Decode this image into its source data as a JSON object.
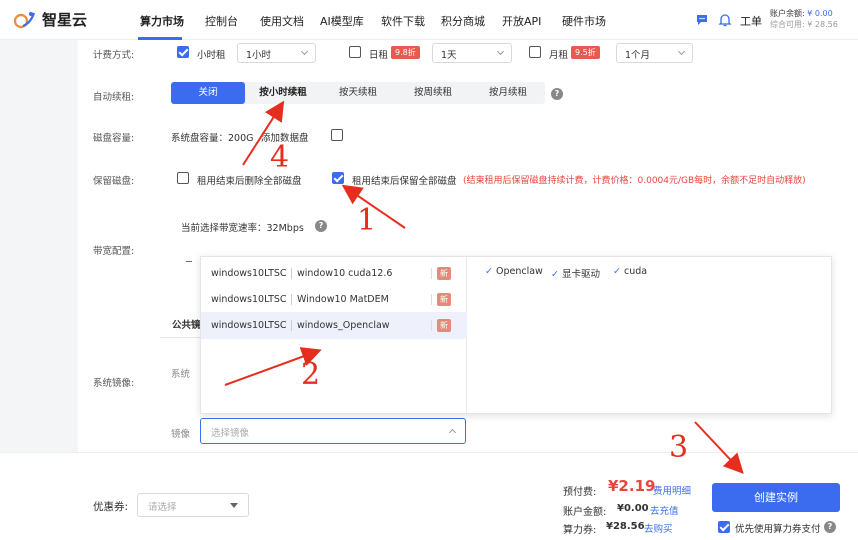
{
  "nav": {
    "logo_text": "智星云",
    "items": [
      "算力市场",
      "控制台",
      "使用文档",
      "AI模型库",
      "软件下载",
      "积分商城",
      "开放API",
      "硬件市场"
    ],
    "ticket": "工单",
    "account_balance_label": "账户余额:",
    "account_balance_value": "¥ 0.00",
    "compute_available_label": "综合可用:",
    "compute_available_value": "¥ 28.56"
  },
  "billing": {
    "label": "计费方式:",
    "hourly": {
      "label": "小时租",
      "select": "1小时",
      "checked": true
    },
    "daily": {
      "label": "日租",
      "badge": "9.8折",
      "select": "1天",
      "checked": false
    },
    "monthly": {
      "label": "月租",
      "badge": "9.5折",
      "select": "1个月",
      "checked": false
    }
  },
  "auto_renew": {
    "label": "自动续租:",
    "options": [
      "关闭",
      "按小时续租",
      "按天续租",
      "按周续租",
      "按月续租"
    ],
    "active_index": 0
  },
  "disk": {
    "label": "磁盘容量:",
    "system_disk": "系统盘容量：200G",
    "add_data_disk": "添加数据盘"
  },
  "keep_disk": {
    "label": "保留磁盘:",
    "option_delete": "租用结束后删除全部磁盘",
    "option_keep": "租用结束后保留全部磁盘",
    "note": "(结束租用后保留磁盘持续计费，计费价格：0.0004元/GB每时，余额不足时自动释放)"
  },
  "bandwidth": {
    "label": "带宽配置:",
    "current": "当前选择带宽速率：32Mbps"
  },
  "image": {
    "section_label": "系统镜像:",
    "tab_public": "公共镜",
    "system_label": "系统",
    "mirror_label": "镜像",
    "mirror_placeholder": "选择镜像",
    "dropdown": [
      {
        "os": "windows10LTSC",
        "name": "window10 cuda12.6",
        "badge": "新"
      },
      {
        "os": "windows10LTSC",
        "name": "Window10 MatDEM",
        "badge": "新"
      },
      {
        "os": "windows10LTSC",
        "name": "windows_Openclaw",
        "badge": "新"
      }
    ],
    "tags": [
      "Openclaw",
      "显卡驱动",
      "cuda"
    ]
  },
  "footer": {
    "coupon_label": "优惠券:",
    "coupon_placeholder": "请选择",
    "prepay_label": "预付费:",
    "prepay_value": "¥2.19",
    "fee_detail": "费用明细",
    "balance_label": "账户金额:",
    "balance_value": "¥0.00",
    "recharge": "去充值",
    "voucher_label": "算力券:",
    "voucher_value": "¥28.56",
    "buy": "去购买",
    "create_button": "创建实例",
    "prefer_voucher": "优先使用算力券支付"
  },
  "annotations": [
    "1",
    "2",
    "3",
    "4"
  ],
  "colors": {
    "accent": "#3b6cf0",
    "badge_red": "#e85a4f",
    "annotation_red": "#e62e1f"
  }
}
